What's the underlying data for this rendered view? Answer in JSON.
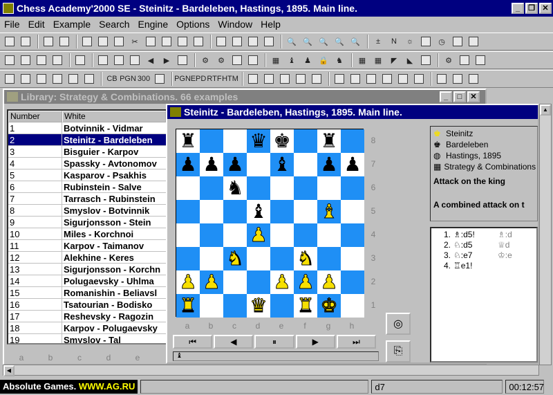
{
  "window": {
    "title": "Chess Academy'2000 SE - Steinitz - Bardeleben, Hastings, 1895. Main line."
  },
  "menu": [
    "File",
    "Edit",
    "Example",
    "Search",
    "Engine",
    "Options",
    "Window",
    "Help"
  ],
  "library": {
    "title": "Library: Strategy & Combinations. 66 examples",
    "col_number": "Number",
    "col_white": "White",
    "rows": [
      {
        "n": "1",
        "w": "Botvinnik - Vidmar"
      },
      {
        "n": "2",
        "w": "Steinitz - Bardeleben"
      },
      {
        "n": "3",
        "w": "Bisguier - Karpov"
      },
      {
        "n": "4",
        "w": "Spassky - Avtonomov"
      },
      {
        "n": "5",
        "w": "Kasparov - Psakhis"
      },
      {
        "n": "6",
        "w": "Rubinstein - Salve"
      },
      {
        "n": "7",
        "w": "Tarrasch - Rubinstein"
      },
      {
        "n": "8",
        "w": "Smyslov - Botvinnik"
      },
      {
        "n": "9",
        "w": "Sigurjonsson - Stein"
      },
      {
        "n": "10",
        "w": "Miles - Korchnoi"
      },
      {
        "n": "11",
        "w": "Karpov - Taimanov"
      },
      {
        "n": "12",
        "w": "Alekhine - Keres"
      },
      {
        "n": "13",
        "w": "Sigurjonsson - Korchn"
      },
      {
        "n": "14",
        "w": "Polugaevsky - Uhlma"
      },
      {
        "n": "15",
        "w": "Romanishin - Beliavsl"
      },
      {
        "n": "16",
        "w": "Tsatourian - Bodisko"
      },
      {
        "n": "17",
        "w": "Reshevsky - Ragozin"
      },
      {
        "n": "18",
        "w": "Karpov - Polugaevsky"
      },
      {
        "n": "19",
        "w": "Smyslov - Tal"
      }
    ],
    "files": [
      "a",
      "b",
      "c",
      "d",
      "e"
    ]
  },
  "game": {
    "title": "Steinitz - Bardeleben, Hastings, 1895. Main line.",
    "board": [
      [
        "r",
        "",
        "",
        "q",
        "k",
        "",
        "r",
        ""
      ],
      [
        "p",
        "p",
        "p",
        "",
        "b",
        "",
        "p",
        "p"
      ],
      [
        "",
        "",
        "n",
        "",
        "",
        "",
        "",
        ""
      ],
      [
        "",
        "",
        "",
        "b",
        "",
        "",
        "B",
        ""
      ],
      [
        "",
        "",
        "",
        "P",
        "",
        "",
        "",
        ""
      ],
      [
        "",
        "",
        "N",
        "",
        "",
        "N",
        "",
        ""
      ],
      [
        "P",
        "P",
        "",
        "",
        "P",
        "P",
        "P",
        ""
      ],
      [
        "R",
        "",
        "",
        "Q",
        "",
        "R",
        "K",
        ""
      ]
    ],
    "ranks": [
      "8",
      "7",
      "6",
      "5",
      "4",
      "3",
      "2",
      "1"
    ],
    "files": [
      "a",
      "b",
      "c",
      "d",
      "e",
      "f",
      "g",
      "h"
    ],
    "info": {
      "white": "Steinitz",
      "black": "Bardeleben",
      "event": "Hastings, 1895",
      "library": "Strategy & Combinations",
      "theme": "Attack on the king",
      "comment": "A combined attack on t"
    },
    "moves": [
      {
        "num": "1.",
        "w": "♗:d5!",
        "b": "♗:d"
      },
      {
        "num": "2.",
        "w": "♘:d5",
        "b": "♕d"
      },
      {
        "num": "3.",
        "w": "♘:e7",
        "b": "♔:e"
      },
      {
        "num": "4.",
        "w": "♖e1!",
        "b": ""
      }
    ],
    "status_char": "♝"
  },
  "statusbar": {
    "brand": "Absolute Games.",
    "brand_url": "WWW.AG.RU",
    "square": "d7",
    "time": "00:12:57"
  }
}
